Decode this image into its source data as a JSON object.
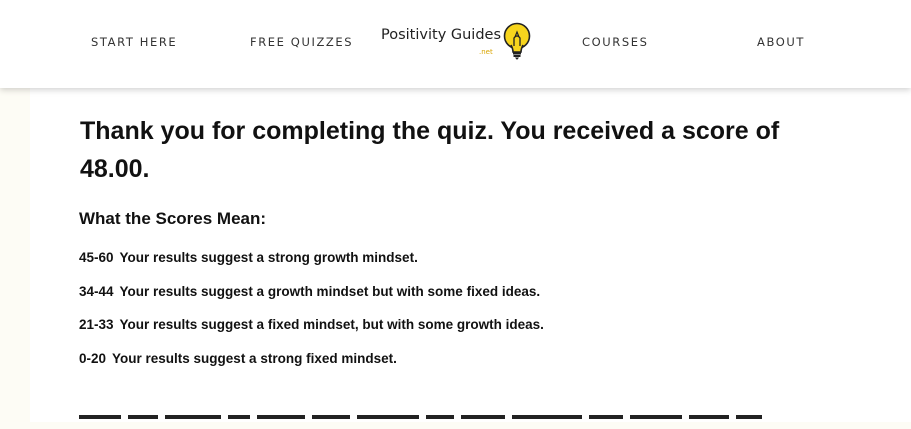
{
  "nav": {
    "start_here": "START HERE",
    "free_quizzes": "FREE QUIZZES",
    "courses": "COURSES",
    "about": "ABOUT"
  },
  "logo": {
    "name": "Positivity Guides",
    "suffix": ".net",
    "icon": "lightbulb-icon"
  },
  "result": {
    "headline": "Thank you for completing the quiz. You received a score of 48.00.",
    "score": "48.00"
  },
  "scores": {
    "heading": "What the Scores Mean:",
    "rows": [
      {
        "range": "45-60",
        "text": "Your results suggest a strong growth mindset."
      },
      {
        "range": "34-44",
        "text": "Your results suggest a growth mindset but with some fixed ideas."
      },
      {
        "range": "21-33",
        "text": "Your results suggest a fixed mindset, but with some growth ideas."
      },
      {
        "range": "0-20",
        "text": "Your results suggest a strong fixed mindset."
      }
    ]
  },
  "colors": {
    "page_background": "#fdfcf5",
    "content_background": "#ffffff",
    "bulb_yellow": "#f7d51d",
    "logo_accent": "#d9a400"
  }
}
